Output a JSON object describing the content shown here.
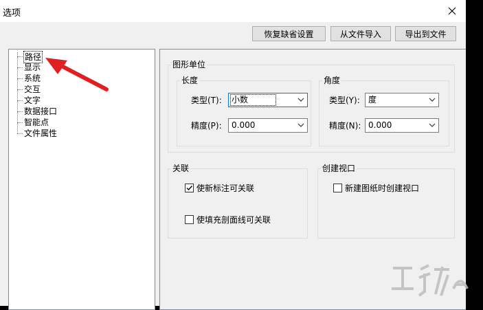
{
  "window": {
    "title": "选项",
    "close_icon": "close-icon"
  },
  "toolbar": {
    "restore_defaults": "恢复缺省设置",
    "import_from_file": "从文件导入",
    "export_to_file": "导出到文件"
  },
  "tree": {
    "items": [
      "路径",
      "显示",
      "系统",
      "交互",
      "文字",
      "数据接口",
      "智能点",
      "文件属性"
    ]
  },
  "graphic_units": {
    "title": "图形单位",
    "length": {
      "title": "长度",
      "type_label": "类型(T):",
      "type_value": "小数",
      "precision_label": "精度(P):",
      "precision_value": "0.000"
    },
    "angle": {
      "title": "角度",
      "type_label": "类型(Y):",
      "type_value": "度",
      "precision_label": "精度(N):",
      "precision_value": "0.000"
    }
  },
  "association": {
    "title": "关联",
    "new_dim_label": "使新标注可关联",
    "new_dim_checked": true,
    "hatch_label": "使填充剖面线可关联",
    "hatch_checked": false
  },
  "create_viewport": {
    "title": "创建视口",
    "new_layout_label": "新建图纸时创建视口",
    "new_layout_checked": false
  },
  "colors": {
    "arrow": "#e02020",
    "watermark": "#bdbdbd"
  }
}
